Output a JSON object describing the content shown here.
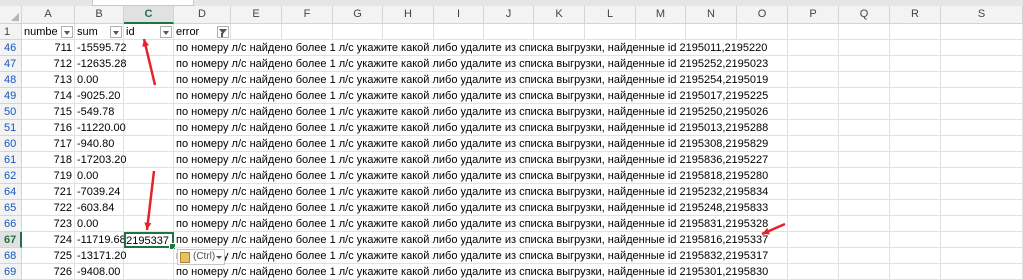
{
  "columns": [
    "A",
    "B",
    "C",
    "D",
    "E",
    "F",
    "G",
    "H",
    "I",
    "J",
    "K",
    "L",
    "M",
    "N",
    "O",
    "P",
    "Q",
    "R",
    "S"
  ],
  "selected_column": "C",
  "header_row": {
    "row_number": "1",
    "a": "numbe",
    "b": "sum",
    "c": "id",
    "d": "error"
  },
  "rows": [
    {
      "n": "46",
      "a": "711",
      "b": "-15595.72",
      "c": "",
      "d": "по номеру л/с найдено более 1 л/с укажите какой либо удалите из списка выгрузки, найденные id 2195011,2195220"
    },
    {
      "n": "47",
      "a": "712",
      "b": "-12635.28",
      "c": "",
      "d": "по номеру л/с найдено более 1 л/с укажите какой либо удалите из списка выгрузки, найденные id 2195252,2195023"
    },
    {
      "n": "48",
      "a": "713",
      "b": "0.00",
      "c": "",
      "d": "по номеру л/с найдено более 1 л/с укажите какой либо удалите из списка выгрузки, найденные id 2195254,2195019"
    },
    {
      "n": "49",
      "a": "714",
      "b": "-9025.20",
      "c": "",
      "d": "по номеру л/с найдено более 1 л/с укажите какой либо удалите из списка выгрузки, найденные id 2195017,2195225"
    },
    {
      "n": "50",
      "a": "715",
      "b": "-549.78",
      "c": "",
      "d": "по номеру л/с найдено более 1 л/с укажите какой либо удалите из списка выгрузки, найденные id 2195250,2195026"
    },
    {
      "n": "51",
      "a": "716",
      "b": "-11220.00",
      "c": "",
      "d": "по номеру л/с найдено более 1 л/с укажите какой либо удалите из списка выгрузки, найденные id 2195013,2195288"
    },
    {
      "n": "60",
      "a": "717",
      "b": "-940.80",
      "c": "",
      "d": "по номеру л/с найдено более 1 л/с укажите какой либо удалите из списка выгрузки, найденные id 2195308,2195829"
    },
    {
      "n": "61",
      "a": "718",
      "b": "-17203.20",
      "c": "",
      "d": "по номеру л/с найдено более 1 л/с укажите какой либо удалите из списка выгрузки, найденные id 2195836,2195227"
    },
    {
      "n": "62",
      "a": "719",
      "b": "0.00",
      "c": "",
      "d": "по номеру л/с найдено более 1 л/с укажите какой либо удалите из списка выгрузки, найденные id 2195818,2195280"
    },
    {
      "n": "64",
      "a": "721",
      "b": "-7039.24",
      "c": "",
      "d": "по номеру л/с найдено более 1 л/с укажите какой либо удалите из списка выгрузки, найденные id 2195232,2195834"
    },
    {
      "n": "65",
      "a": "722",
      "b": "-603.84",
      "c": "",
      "d": "по номеру л/с найдено более 1 л/с укажите какой либо удалите из списка выгрузки, найденные id 2195248,2195833"
    },
    {
      "n": "66",
      "a": "723",
      "b": "0.00",
      "c": "",
      "d": "по номеру л/с найдено более 1 л/с укажите какой либо удалите из списка выгрузки, найденные id 2195831,2195328"
    },
    {
      "n": "67",
      "a": "724",
      "b": "-11719.68",
      "c": "2195337",
      "d": "по номеру л/с найдено более 1 л/с укажите какой либо удалите из списка выгрузки, найденные id 2195816,2195337"
    },
    {
      "n": "68",
      "a": "725",
      "b": "-13171.20",
      "c": "",
      "d": "по номеру л/с найдено более 1 л/с укажите какой либо удалите из списка выгрузки, найденные id 2195832,2195317"
    },
    {
      "n": "69",
      "a": "726",
      "b": "-9408.00",
      "c": "",
      "d": "по номеру л/с найдено более 1 л/с укажите какой либо удалите из списка выгрузки, найденные id 2195301,2195830"
    }
  ],
  "active_row": "67",
  "paste_options_label": "(Ctrl)",
  "accent_color": "#217346",
  "annotation_color": "#e8202a",
  "icons": {
    "filter": "filter-dropdown-icon",
    "filter_active": "filter-applied-icon",
    "paste": "clipboard-paste-icon"
  }
}
